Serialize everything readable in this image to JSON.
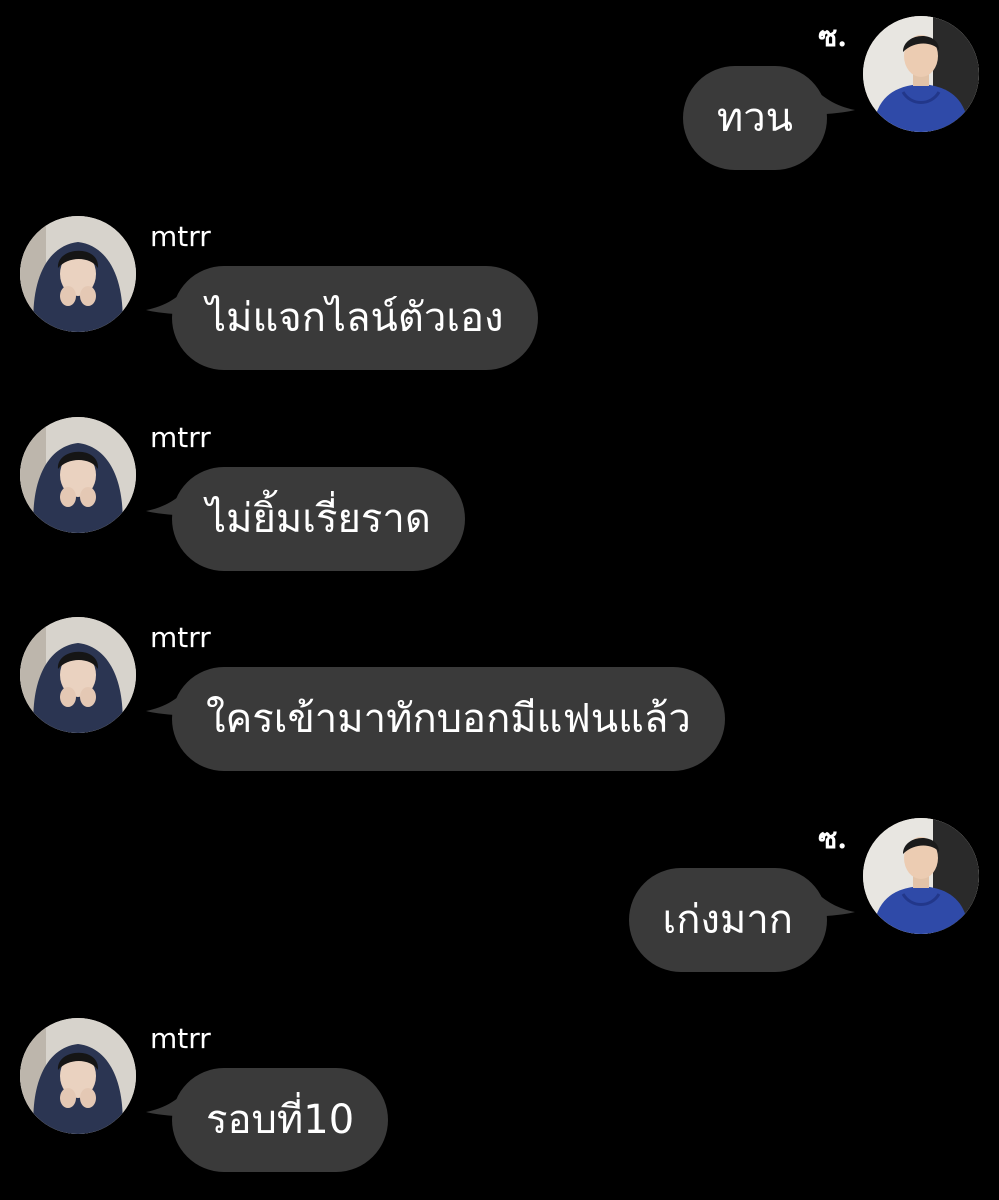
{
  "colors": {
    "background": "#000000",
    "bubble": "#3a3a3a",
    "text": "#ffffff"
  },
  "conversation": {
    "messages": [
      {
        "side": "right",
        "sender": "ซ.",
        "text": "ทวน",
        "avatar_icon": "avatar-blue-hoodie-man"
      },
      {
        "side": "left",
        "sender": "mtrr",
        "text": "ไม่แจกไลน์ตัวเอง",
        "avatar_icon": "avatar-navy-hoodie-person"
      },
      {
        "side": "left",
        "sender": "mtrr",
        "text": "ไม่ยิ้มเรี่ยราด",
        "avatar_icon": "avatar-navy-hoodie-person"
      },
      {
        "side": "left",
        "sender": "mtrr",
        "text": "ใครเข้ามาทักบอกมีแฟนแล้ว",
        "avatar_icon": "avatar-navy-hoodie-person"
      },
      {
        "side": "right",
        "sender": "ซ.",
        "text": "เก่งมาก",
        "avatar_icon": "avatar-blue-hoodie-man"
      },
      {
        "side": "left",
        "sender": "mtrr",
        "text": "รอบที่10",
        "avatar_icon": "avatar-navy-hoodie-person"
      }
    ]
  }
}
